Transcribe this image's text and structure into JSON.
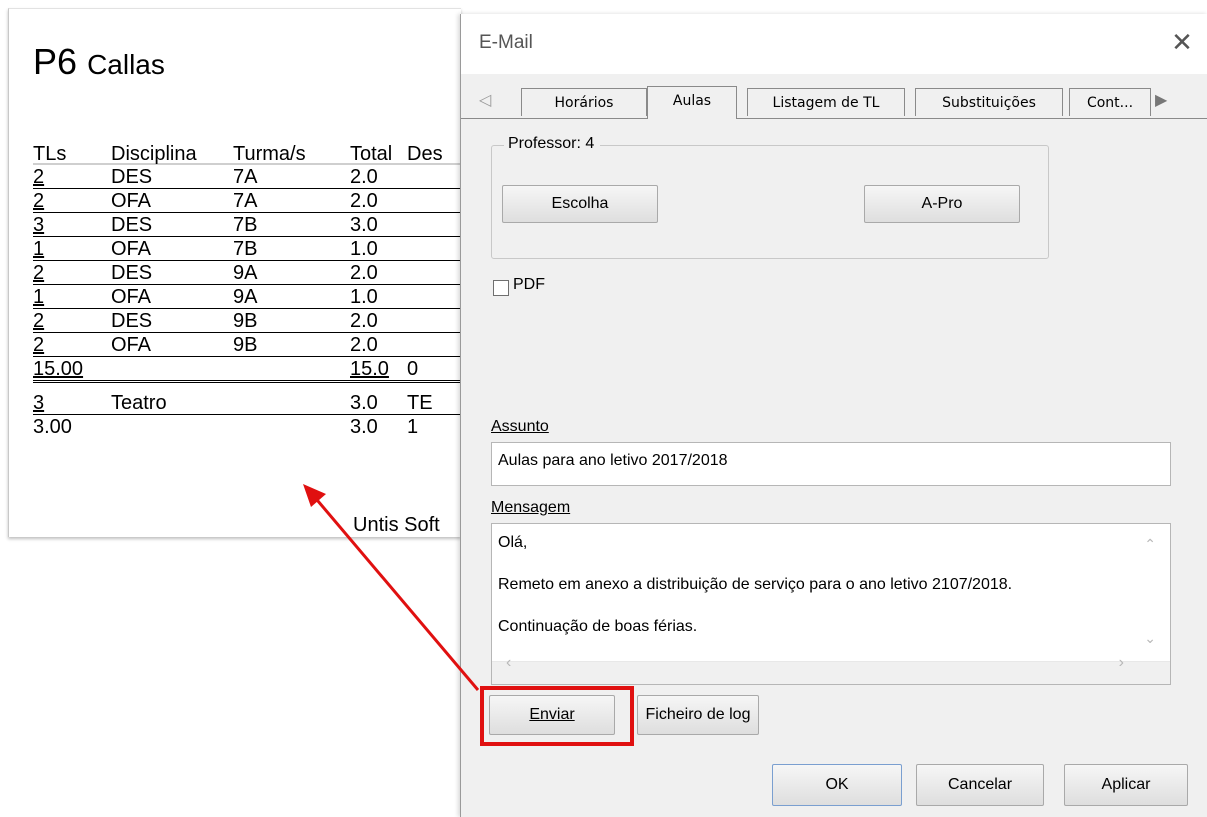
{
  "report": {
    "professor_code": "P6",
    "professor_name": "Callas",
    "headers": [
      "TLs",
      "Disciplina",
      "Turma/s",
      "Total",
      "Des"
    ],
    "rows": [
      [
        "2",
        "DES",
        "7A",
        "2.0",
        ""
      ],
      [
        "2",
        "OFA",
        "7A",
        "2.0",
        ""
      ],
      [
        "3",
        "DES",
        "7B",
        "3.0",
        ""
      ],
      [
        "1",
        "OFA",
        "7B",
        "1.0",
        ""
      ],
      [
        "2",
        "DES",
        "9A",
        "2.0",
        ""
      ],
      [
        "1",
        "OFA",
        "9A",
        "1.0",
        ""
      ],
      [
        "2",
        "DES",
        "9B",
        "2.0",
        ""
      ],
      [
        "2",
        "OFA",
        "9B",
        "2.0",
        ""
      ]
    ],
    "total_row": [
      "15.00",
      "",
      "",
      "15.0",
      "0"
    ],
    "extra_row": [
      "3",
      "Teatro",
      "",
      "3.0",
      "TE"
    ],
    "extra_total": [
      "3.00",
      "",
      "",
      "3.0",
      "1"
    ],
    "footer": "Untis Soft"
  },
  "dialog": {
    "title": "E-Mail",
    "close_label": "✕",
    "tabs": [
      "Horários",
      "Aulas",
      "Listagem de TL",
      "Substituições",
      "Cont..."
    ],
    "active_tab": "Aulas",
    "group_label": "Professor: 4",
    "escolha_label": "Escolha",
    "apro_label": "A-Pro",
    "pdf_label": "PDF",
    "pdf_checked": false,
    "assunto_label": "Assunto",
    "assunto_value": "Aulas para ano letivo 2017/2018",
    "mensagem_label": "Mensagem",
    "mensagem_lines": [
      "Olá,",
      "Remeto em anexo a distribuição de serviço para o ano letivo 2107/2018.",
      "Continuação de boas férias."
    ],
    "enviar_label": "Enviar",
    "ficheiro_log_label": "Ficheiro de log",
    "ok_label": "OK",
    "cancelar_label": "Cancelar",
    "aplicar_label": "Aplicar"
  },
  "colors": {
    "highlight": "#e01010"
  }
}
